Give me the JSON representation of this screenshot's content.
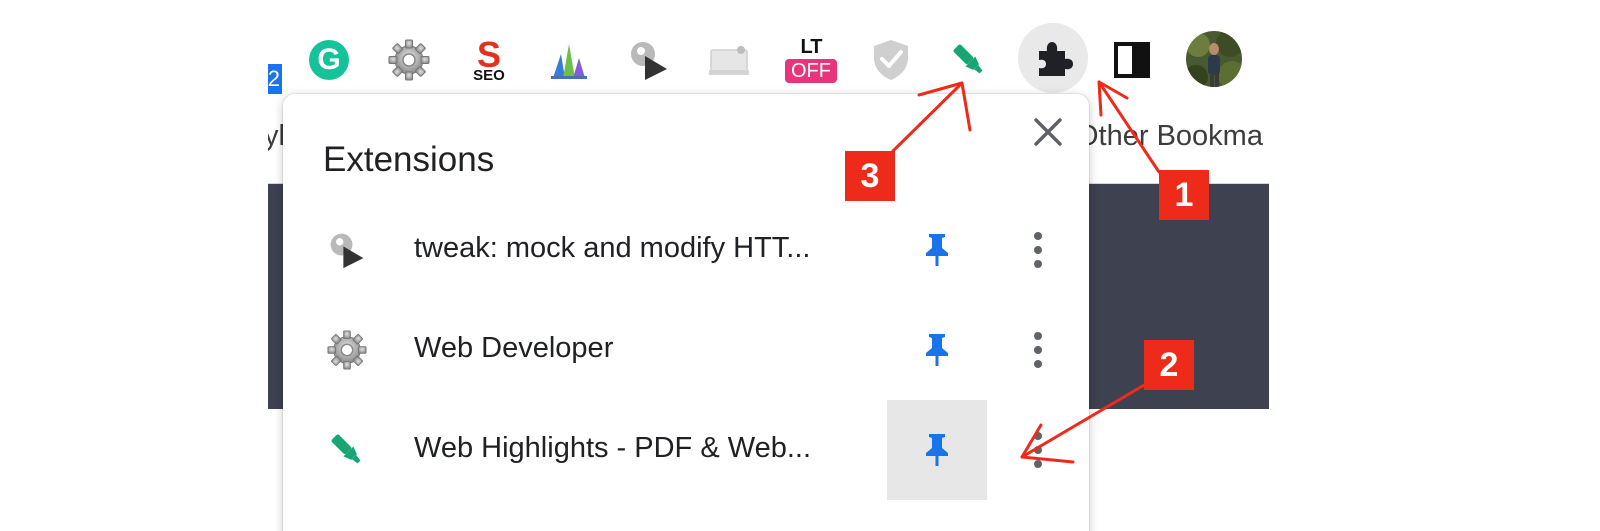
{
  "toolbar": {
    "left_bookmark_fragment": "yl",
    "edge_badge": "2",
    "icons": [
      {
        "name": "grammarly-icon",
        "glyph": "G"
      },
      {
        "name": "web-developer-gear-icon"
      },
      {
        "name": "seo-icon",
        "top": "S",
        "bottom": "SEO"
      },
      {
        "name": "bar-chart-extension-icon"
      },
      {
        "name": "tweak-play-icon"
      },
      {
        "name": "device-extension-icon"
      },
      {
        "name": "languagetool-icon",
        "top": "LT",
        "badge": "OFF"
      },
      {
        "name": "shield-check-icon"
      },
      {
        "name": "highlighter-icon"
      },
      {
        "name": "extensions-puzzle-icon"
      },
      {
        "name": "side-panel-icon"
      },
      {
        "name": "profile-avatar"
      }
    ],
    "other_bookmarks": "Other Bookma"
  },
  "colors": {
    "accent_blue": "#1a73e8",
    "dark_panel": "#3d4150",
    "annotation_red": "#ee2a1a",
    "highlighter_green": "#17a673",
    "grammarly_green": "#15c39a",
    "lt_pink": "#e8347a"
  },
  "extensions_popup": {
    "title": "Extensions",
    "close_icon": "close-icon",
    "items": [
      {
        "name": "tweak: mock and modify HTT...",
        "icon": "tweak-play-icon",
        "pinned": true
      },
      {
        "name": "Web Developer",
        "icon": "gear-icon",
        "pinned": true
      },
      {
        "name": "Web Highlights - PDF & Web...",
        "icon": "highlighter-icon",
        "pinned": true
      }
    ]
  },
  "annotations": {
    "callout_1": "1",
    "callout_2": "2",
    "callout_3": "3"
  }
}
